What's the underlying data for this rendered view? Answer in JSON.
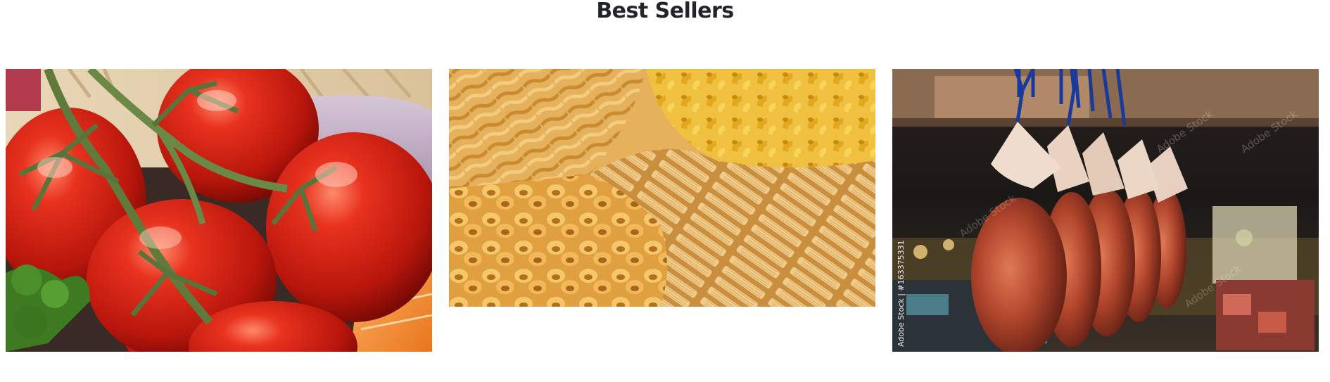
{
  "section": {
    "title": "Best Sellers"
  },
  "products": [
    {
      "image": "tomatoes-photo"
    },
    {
      "image": "pasta-photo"
    },
    {
      "image": "jamon-photo",
      "stock_credit": "Adobe Stock | #163375331",
      "watermark": "Adobe Stock"
    }
  ]
}
